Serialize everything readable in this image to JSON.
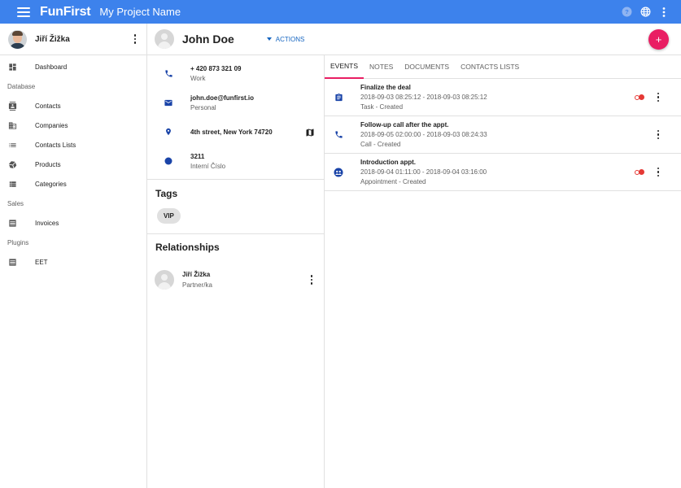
{
  "appbar": {
    "logo": "FunFirst",
    "project_name": "My Project Name",
    "icons": [
      "menu-icon",
      "help-icon",
      "globe-icon",
      "more-vert-icon"
    ],
    "color": "#3d82ec"
  },
  "sidebar": {
    "user_name": "Jiří Žižka",
    "items": [
      {
        "type": "item",
        "label": "Dashboard",
        "icon": "dashboard-icon"
      },
      {
        "type": "section",
        "label": "Database"
      },
      {
        "type": "item",
        "label": "Contacts",
        "icon": "contacts-icon"
      },
      {
        "type": "item",
        "label": "Companies",
        "icon": "companies-icon"
      },
      {
        "type": "item",
        "label": "Contacts Lists",
        "icon": "list-icon"
      },
      {
        "type": "item",
        "label": "Products",
        "icon": "products-icon"
      },
      {
        "type": "item",
        "label": "Categories",
        "icon": "categories-icon"
      },
      {
        "type": "section",
        "label": "Sales"
      },
      {
        "type": "item",
        "label": "Invoices",
        "icon": "invoices-icon"
      },
      {
        "type": "section",
        "label": "Plugins"
      },
      {
        "type": "item",
        "label": "EET",
        "icon": "eet-icon"
      }
    ]
  },
  "contact": {
    "name": "John Doe",
    "actions_label": "ACTIONS",
    "fab_label": "+",
    "details": [
      {
        "main": "+ 420 873 321 09",
        "sub": "Work",
        "icon": "phone-icon"
      },
      {
        "main": "john.doe@funfirst.io",
        "sub": "Personal",
        "icon": "email-icon"
      },
      {
        "main": "4th street, New York 74720",
        "sub": "",
        "icon": "location-icon"
      },
      {
        "main": "3211",
        "sub": "Interní Číslo",
        "icon": "dot-icon"
      }
    ],
    "tags_title": "Tags",
    "tags": [
      "VIP"
    ],
    "relationships_title": "Relationships",
    "relationships": [
      {
        "name": "Jiří Žižka",
        "role": "Partner/ka"
      }
    ]
  },
  "tabs": [
    {
      "label": "EVENTS",
      "active": true
    },
    {
      "label": "NOTES",
      "active": false
    },
    {
      "label": "DOCUMENTS",
      "active": false
    },
    {
      "label": "CONTACTS LISTS",
      "active": false
    }
  ],
  "events": [
    {
      "title": "Finalize the deal",
      "time": "2018-09-03 08:25:12 - 2018-09-03 08:25:12",
      "status": "Task - Created",
      "icon": "task-icon",
      "marked": true
    },
    {
      "title": "Follow-up call after the appt.",
      "time": "2018-09-05 02:00:00 - 2018-09-03 08:24:33",
      "status": "Call - Created",
      "icon": "phone-icon",
      "marked": false
    },
    {
      "title": "Introduction appt.",
      "time": "2018-09-04 01:11:00 - 2018-09-04 03:16:00",
      "status": "Appointment - Created",
      "icon": "appointment-icon",
      "marked": true
    }
  ],
  "colors": {
    "accent": "#e91e63",
    "icon_blue": "#1a44a8",
    "marker_red": "#e53935"
  }
}
